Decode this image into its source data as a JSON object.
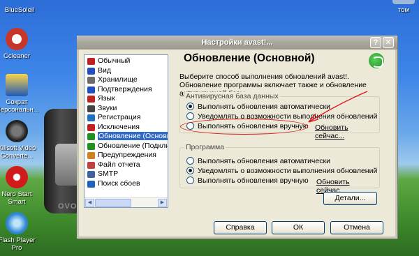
{
  "desktop": {
    "icons": [
      {
        "label": "BlueSoleil",
        "icon": "bluesoleil-icon",
        "color": "#2a6fd6"
      },
      {
        "label": "Ccleaner",
        "icon": "ccleaner-icon",
        "color": "#c8362a"
      },
      {
        "label": "Сократ Персональн...",
        "icon": "socrat-icon",
        "color": "#1f58b8"
      },
      {
        "label": "Xilisoft Video Converte...",
        "icon": "xilisoft-icon",
        "color": "#303030"
      },
      {
        "label": "Nero Start Smart",
        "icon": "nero-icon",
        "color": "#d11b1b"
      },
      {
        "label": "Flash Player Pro",
        "icon": "flash-player-icon",
        "color": "#2f86d0"
      }
    ],
    "right_icon_label": "том",
    "player_label": "OVO"
  },
  "window": {
    "title": "Настройки avast!...",
    "help_btn": "?",
    "close_btn": "✕"
  },
  "tree": {
    "items": [
      {
        "label": "Обычный",
        "icon_color": "#c02020"
      },
      {
        "label": "Вид",
        "icon_color": "#2050c0"
      },
      {
        "label": "Хранилище",
        "icon_color": "#6b6b6b"
      },
      {
        "label": "Подтверждения",
        "icon_color": "#2050c0"
      },
      {
        "label": "Язык",
        "icon_color": "#c02020"
      },
      {
        "label": "Звуки",
        "icon_color": "#444444"
      },
      {
        "label": "Регистрация",
        "icon_color": "#2070c0"
      },
      {
        "label": "Исключения",
        "icon_color": "#c02020"
      },
      {
        "label": "Обновление (Основной)",
        "icon_color": "#209020",
        "selected": true
      },
      {
        "label": "Обновление (Подключение)",
        "icon_color": "#209020"
      },
      {
        "label": "Предупреждения",
        "icon_color": "#d08020"
      },
      {
        "label": "Файл отчета",
        "icon_color": "#c04040"
      },
      {
        "label": "SMTP",
        "icon_color": "#4060a0"
      },
      {
        "label": "Поиск сбоев",
        "icon_color": "#2060c0"
      }
    ]
  },
  "panel": {
    "heading": "Обновление (Основной)",
    "description": "Выберите способ выполнения обновлений avast!. Обновление программы включает также и обновление антивирусной базы."
  },
  "group_av": {
    "label": "Антивирусная база данных",
    "options": [
      {
        "label": "Выполнять обновления автоматически",
        "checked": true
      },
      {
        "label": "Уведомлять о возможности выполнения обновлений",
        "checked": false
      },
      {
        "label": "Выполнять обновления вручную",
        "checked": false
      }
    ],
    "update_link": "Обновить сейчас..."
  },
  "group_prog": {
    "label": "Программа",
    "options": [
      {
        "label": "Выполнять обновления автоматически",
        "checked": false
      },
      {
        "label": "Уведомлять о возможности выполнения обновлений",
        "checked": true
      },
      {
        "label": "Выполнять обновления вручную",
        "checked": false
      }
    ],
    "update_link": "Обновить сейчас..."
  },
  "buttons": {
    "details": "Детали...",
    "help": "Справка",
    "ok": "ОК",
    "cancel": "Отмена"
  },
  "annotation": {
    "color": "#e0161b"
  }
}
